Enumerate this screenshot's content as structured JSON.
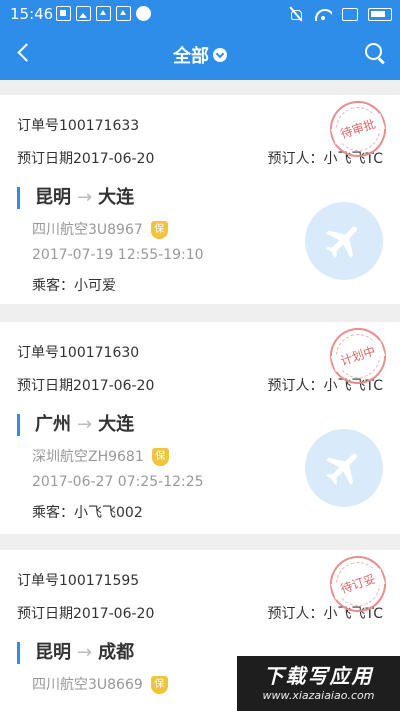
{
  "status_bar": {
    "time": "15:46"
  },
  "app_bar": {
    "title": "全部"
  },
  "orders": [
    {
      "order_no": "订单号100171633",
      "order_date": "预订日期2017-06-20",
      "booker": "预订人：小飞飞TC",
      "status": "待审批",
      "from": "昆明",
      "arrow": "→",
      "to": "大连",
      "airline": "四川航空3U8967",
      "insurance_badge": "保",
      "flight_time": "2017-07-19   12:55-19:10",
      "passenger": "乘客：小可爱"
    },
    {
      "order_no": "订单号100171630",
      "order_date": "预订日期2017-06-20",
      "booker": "预订人：小飞飞TC",
      "status": "计划中",
      "from": "广州",
      "arrow": "→",
      "to": "大连",
      "airline": "深圳航空ZH9681",
      "insurance_badge": "保",
      "flight_time": "2017-06-27   07:25-12:25",
      "passenger": "乘客：小飞飞002"
    },
    {
      "order_no": "订单号100171595",
      "order_date": "预订日期2017-06-20",
      "booker": "预订人：小飞飞TC",
      "status": "待订妥",
      "from": "昆明",
      "arrow": "→",
      "to": "成都",
      "airline": "四川航空3U8669",
      "insurance_badge": "保"
    }
  ],
  "watermark": {
    "main": "下载写应用",
    "url": "www.xiazaiaiao.com"
  },
  "colors": {
    "primary": "#2e8de8",
    "stamp": "#e06868",
    "badge": "#f0c43f"
  }
}
